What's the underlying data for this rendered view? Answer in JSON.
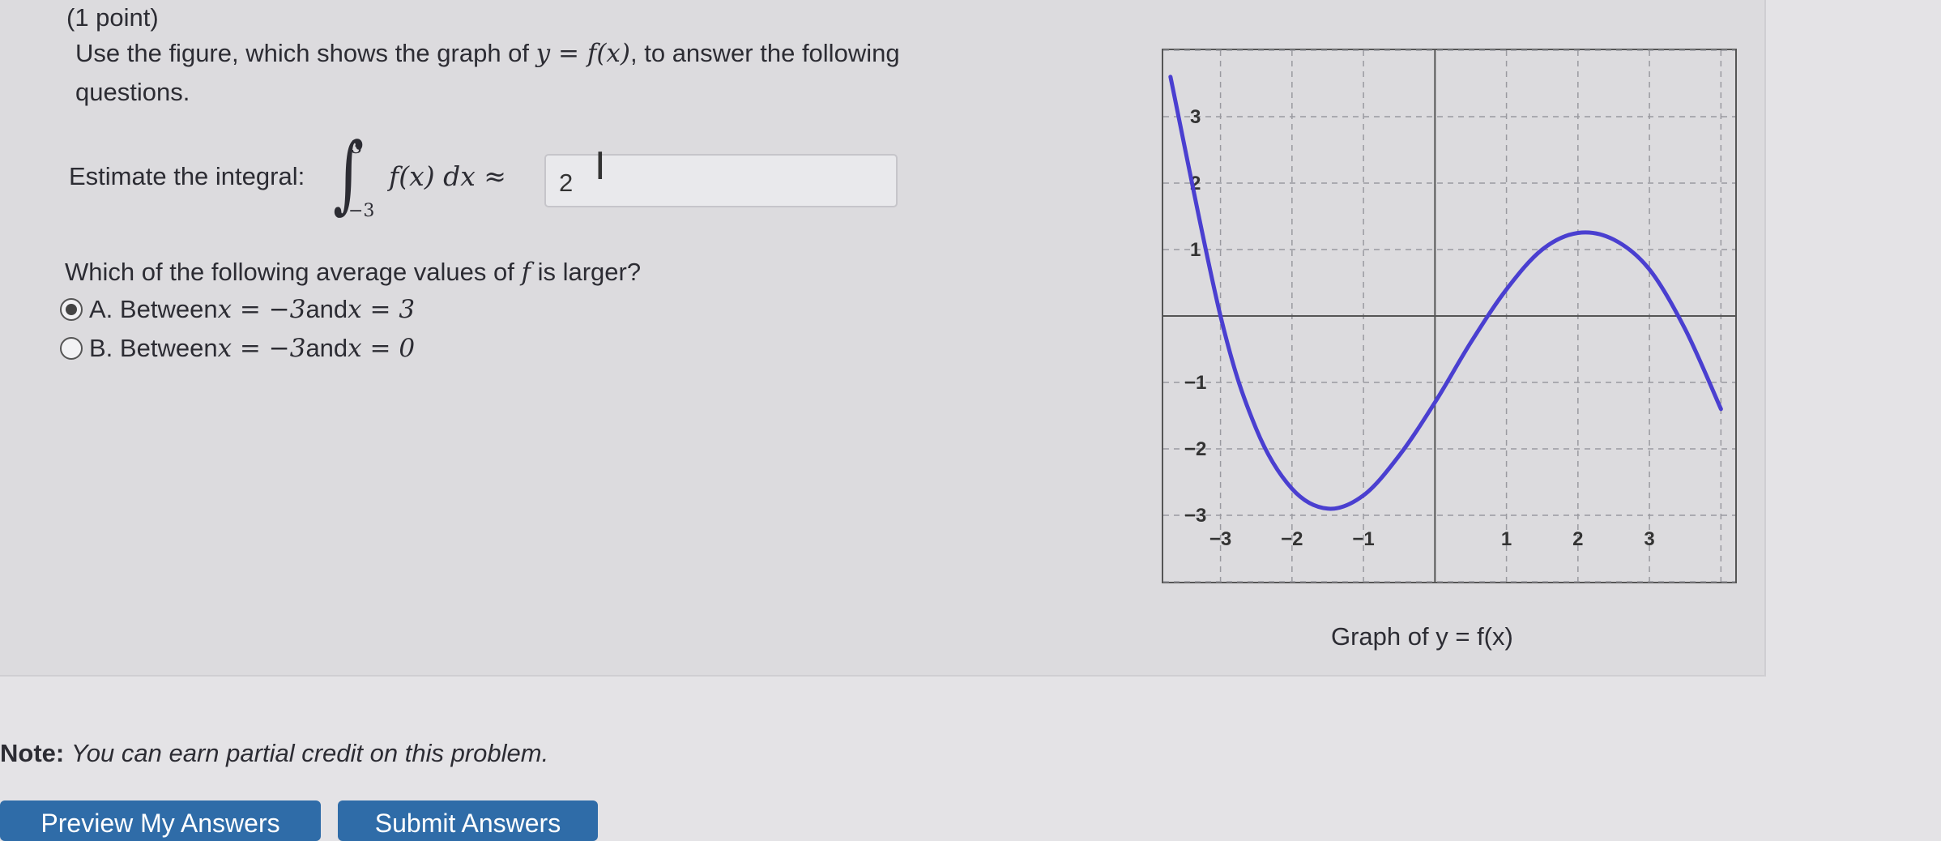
{
  "problem": {
    "points": "(1 point)",
    "intro_text_1": "Use the figure, which shows the graph of ",
    "intro_math": "y = f(x)",
    "intro_text_2": ", to answer the following questions."
  },
  "estimate": {
    "label": "Estimate the integral:",
    "upper_limit": "3",
    "lower_limit": "−3",
    "integrand": "f(x) dx ≈",
    "answer_value": "2"
  },
  "question2": {
    "text_1": "Which of the following average values of ",
    "text_var": "f",
    "text_2": " is larger?",
    "options": [
      {
        "letter": "A.",
        "text_1": "Between ",
        "math_1": "x = −3",
        "text_2": " and ",
        "math_2": "x = 3",
        "selected": true
      },
      {
        "letter": "B.",
        "text_1": "Between ",
        "math_1": "x = −3",
        "text_2": " and ",
        "math_2": "x = 0",
        "selected": false
      }
    ]
  },
  "chart_data": {
    "type": "line",
    "x_tick_labels": [
      "−3",
      "−2",
      "−1",
      "1",
      "2",
      "3"
    ],
    "y_tick_labels": [
      "3",
      "2",
      "1",
      "−1",
      "−2",
      "−3"
    ],
    "xlim": [
      -3.8,
      4.2
    ],
    "ylim": [
      -4.0,
      4.0
    ],
    "grid": true,
    "grid_style": "dashed",
    "line_color": "#4a3fd0",
    "series": [
      {
        "x": [
          -3.7,
          -3.0,
          -2.5,
          -2.0,
          -1.5,
          -1.0,
          -0.5,
          0.0,
          0.5,
          1.0,
          1.5,
          2.0,
          2.5,
          3.0,
          3.5,
          4.0
        ],
        "y": [
          3.6,
          0.0,
          -1.7,
          -2.6,
          -2.9,
          -2.7,
          -2.1,
          -1.3,
          -0.4,
          0.4,
          1.0,
          1.25,
          1.15,
          0.7,
          -0.2,
          -1.4
        ]
      }
    ]
  },
  "graph_caption": "Graph of y = f(x)",
  "note": {
    "label": "Note:",
    "text": "You can earn partial credit on this problem."
  },
  "buttons": {
    "preview": "Preview My Answers",
    "submit": "Submit Answers"
  }
}
